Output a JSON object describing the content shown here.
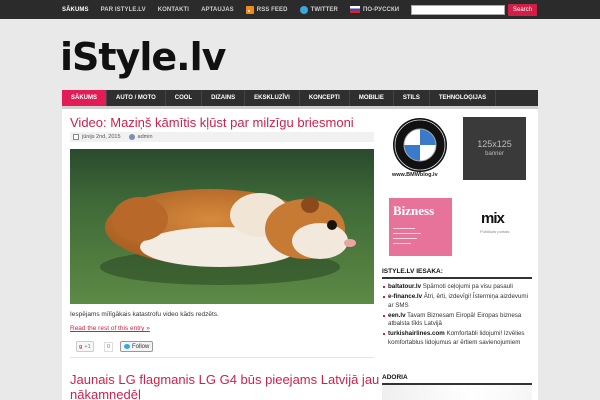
{
  "topnav": {
    "items": [
      "SĀKUMS",
      "PAR ISTYLE.LV",
      "KONTAKTI",
      "APTAUJAS",
      "RSS FEED",
      "TWITTER",
      "ПО-РУССКИ"
    ],
    "search_button": "Search"
  },
  "logo": "iStyle.lv",
  "mainnav": {
    "items": [
      "SĀKUMS",
      "AUTO / MOTO",
      "COOL",
      "DIZAINS",
      "EKSKLUZĪVI",
      "KONCEPTI",
      "MOBILIE",
      "STILS",
      "TEHNOLOĢIJAS"
    ]
  },
  "post": {
    "title": "Video: Maziņš kāmītis kļūst par milzīgu briesmoni",
    "date": "jūnijs 2nd, 2015",
    "author": "admin",
    "excerpt": "Iespējams mīlīgākais katastrofu video kāds redzēts.",
    "read_more": "Read the rest of this entry »",
    "gplus": "+1",
    "gplus_count": "0",
    "follow": "Follow"
  },
  "post2": {
    "title": "Jaunais LG flagmanis LG G4 būs pieejams Latvijā jau nākamnedēļ"
  },
  "sidebar": {
    "bmw_caption": "www.BMWblog.lv",
    "banner_big": "125x125",
    "banner_small": "banner",
    "bizness": "Bizness",
    "mix": "mix",
    "mix_sub": "Publikuts portals",
    "recommends_heading": "ISTYLE.LV IESAKA:",
    "recommends": [
      {
        "site": "baltatour.lv",
        "text": " Spārnoti ceļojumi pa visu pasauli"
      },
      {
        "site": "e-finance.lv",
        "text": " Ātri, ērti, izdevīgi! Īstermiņa aizdevumi ar SMS"
      },
      {
        "site": "een.lv",
        "text": " Tavam Biznesam Eiropā! Eiropas biznesa atbalsta tīkls Latvijā"
      },
      {
        "site": "turkishairlines.com",
        "text": " Komfortabli lidojumi! Izvēlies komfortablus lidojumus ar ērtiem savienojumiem"
      }
    ],
    "adoria_heading": "ADORIA"
  }
}
